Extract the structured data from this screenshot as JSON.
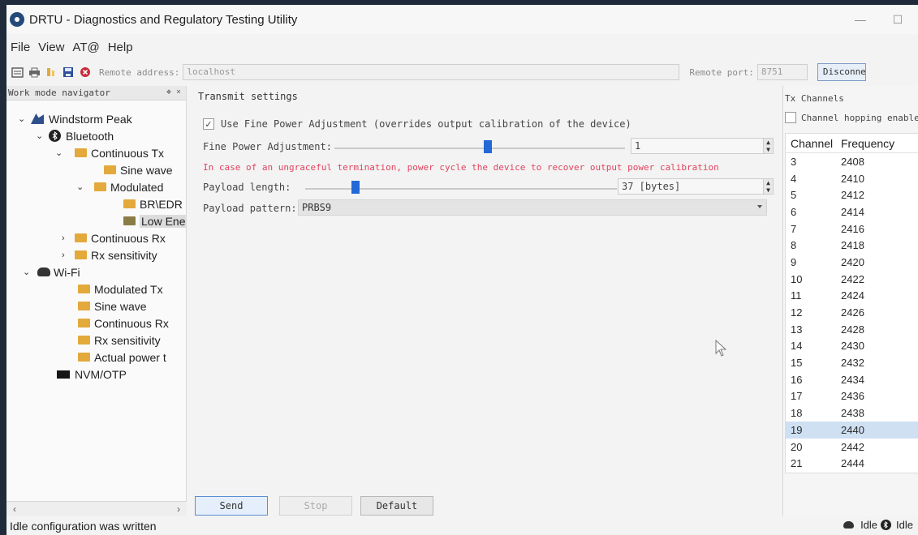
{
  "window": {
    "title": "DRTU - Diagnostics and Regulatory Testing Utility",
    "menu": [
      "File",
      "View",
      "AT@",
      "Help"
    ]
  },
  "toolbar": {
    "remote_address_label": "Remote address:",
    "remote_address_value": "localhost",
    "remote_port_label": "Remote port:",
    "remote_port_value": "8751",
    "disconnect_label": "Disconnect"
  },
  "navigator": {
    "title": "Work mode navigator",
    "header_buttons": "❖ ×",
    "items": [
      {
        "label": "Windstorm Peak"
      },
      {
        "label": "Bluetooth"
      },
      {
        "label": "Continuous Tx"
      },
      {
        "label": "Sine wave"
      },
      {
        "label": "Modulated"
      },
      {
        "label": "BR\\EDR"
      },
      {
        "label": "Low Ene"
      },
      {
        "label": "Continuous Rx"
      },
      {
        "label": "Rx sensitivity"
      },
      {
        "label": "Wi-Fi"
      },
      {
        "label": "Modulated Tx"
      },
      {
        "label": "Sine wave"
      },
      {
        "label": "Continuous Rx"
      },
      {
        "label": "Rx sensitivity"
      },
      {
        "label": "Actual power t"
      },
      {
        "label": "NVM/OTP"
      }
    ]
  },
  "transmit": {
    "title": "Transmit settings",
    "fine_power_checkbox_label": "Use Fine Power Adjustment (overrides output calibration of the device)",
    "fine_power_label": "Fine Power Adjustment:",
    "fine_power_value": "1",
    "warning": "In case of an ungraceful termination, power cycle the device to recover output power calibration",
    "payload_length_label": "Payload length:",
    "payload_length_value": "37 [bytes]",
    "payload_pattern_label": "Payload pattern:",
    "payload_pattern_value": "PRBS9"
  },
  "buttons": {
    "send": "Send",
    "stop": "Stop",
    "default": "Default"
  },
  "tx_channels": {
    "title": "Tx Channels",
    "hopping_label": "Channel hopping enabled",
    "columns": [
      "Channel",
      "Frequency"
    ],
    "rows": [
      {
        "channel": "3",
        "frequency": "2408"
      },
      {
        "channel": "4",
        "frequency": "2410"
      },
      {
        "channel": "5",
        "frequency": "2412"
      },
      {
        "channel": "6",
        "frequency": "2414"
      },
      {
        "channel": "7",
        "frequency": "2416"
      },
      {
        "channel": "8",
        "frequency": "2418"
      },
      {
        "channel": "9",
        "frequency": "2420"
      },
      {
        "channel": "10",
        "frequency": "2422"
      },
      {
        "channel": "11",
        "frequency": "2424"
      },
      {
        "channel": "12",
        "frequency": "2426"
      },
      {
        "channel": "13",
        "frequency": "2428"
      },
      {
        "channel": "14",
        "frequency": "2430"
      },
      {
        "channel": "15",
        "frequency": "2432"
      },
      {
        "channel": "16",
        "frequency": "2434"
      },
      {
        "channel": "17",
        "frequency": "2436"
      },
      {
        "channel": "18",
        "frequency": "2438"
      },
      {
        "channel": "19",
        "frequency": "2440"
      },
      {
        "channel": "20",
        "frequency": "2442"
      },
      {
        "channel": "21",
        "frequency": "2444"
      }
    ],
    "selected_channel": "19"
  },
  "status": {
    "message": "Idle configuration was written",
    "wifi_state": "Idle",
    "bt_state": "Idle"
  },
  "colors": {
    "accent": "#2468d8",
    "warning": "#e2435f",
    "selection": "#cfe0f3"
  }
}
